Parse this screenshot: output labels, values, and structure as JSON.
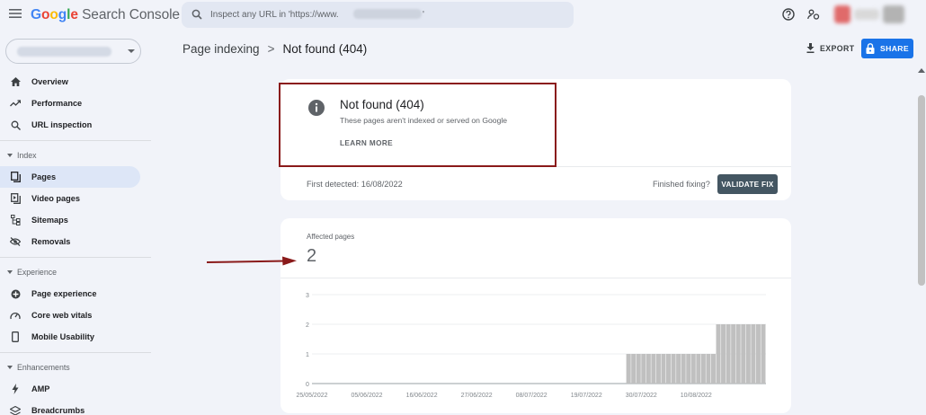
{
  "app": {
    "logo_google": "Google",
    "logo_product": "Search Console"
  },
  "search": {
    "placeholder": "Inspect any URL in 'https://www.",
    "placeholder_end": "'"
  },
  "header": {
    "breadcrumb_parent": "Page indexing",
    "breadcrumb_separator": ">",
    "breadcrumb_current": "Not found (404)",
    "export_label": "EXPORT",
    "share_label": "SHARE"
  },
  "sidebar": {
    "items": [
      {
        "label": "Overview",
        "icon": "home-icon"
      },
      {
        "label": "Performance",
        "icon": "trending-icon"
      },
      {
        "label": "URL inspection",
        "icon": "search-icon"
      }
    ],
    "sections": [
      {
        "title": "Index",
        "items": [
          {
            "label": "Pages",
            "icon": "pages-icon",
            "active": true
          },
          {
            "label": "Video pages",
            "icon": "video-pages-icon"
          },
          {
            "label": "Sitemaps",
            "icon": "sitemap-icon"
          },
          {
            "label": "Removals",
            "icon": "removals-icon"
          }
        ]
      },
      {
        "title": "Experience",
        "items": [
          {
            "label": "Page experience",
            "icon": "page-experience-icon"
          },
          {
            "label": "Core web vitals",
            "icon": "speed-icon"
          },
          {
            "label": "Mobile Usability",
            "icon": "mobile-icon"
          }
        ]
      },
      {
        "title": "Enhancements",
        "items": [
          {
            "label": "AMP",
            "icon": "amp-icon"
          },
          {
            "label": "Breadcrumbs",
            "icon": "breadcrumbs-icon"
          }
        ]
      }
    ]
  },
  "issue_card": {
    "title": "Not found (404)",
    "subtitle": "These pages aren't indexed or served on Google",
    "learn_more": "LEARN MORE",
    "first_detected": "First detected: 16/08/2022",
    "finished_fixing": "Finished fixing?",
    "validate_label": "VALIDATE FIX"
  },
  "affected_card": {
    "label": "Affected pages",
    "value": "2"
  },
  "colors": {
    "accent": "#1a73e8",
    "validate_bg": "#445662",
    "highlight": "#8a1a1a",
    "bars": "#c0c0c0",
    "active_nav": "#dde6f7"
  },
  "chart_data": {
    "type": "bar",
    "ylim": [
      0,
      3
    ],
    "y_ticks": [
      0,
      1,
      2,
      3
    ],
    "x_tick_labels": [
      "25/05/2022",
      "05/06/2022",
      "16/06/2022",
      "27/06/2022",
      "08/07/2022",
      "19/07/2022",
      "30/07/2022",
      "10/08/2022"
    ],
    "start_date": "2022-05-25",
    "daily_values": [
      0,
      0,
      0,
      0,
      0,
      0,
      0,
      0,
      0,
      0,
      0,
      0,
      0,
      0,
      0,
      0,
      0,
      0,
      0,
      0,
      0,
      0,
      0,
      0,
      0,
      0,
      0,
      0,
      0,
      0,
      0,
      0,
      0,
      0,
      0,
      0,
      0,
      0,
      0,
      0,
      0,
      0,
      0,
      0,
      0,
      0,
      0,
      0,
      0,
      0,
      0,
      0,
      0,
      0,
      0,
      0,
      0,
      0,
      0,
      0,
      0,
      0,
      0,
      1,
      1,
      1,
      1,
      1,
      1,
      1,
      1,
      1,
      1,
      1,
      1,
      1,
      1,
      1,
      1,
      1,
      1,
      2,
      2,
      2,
      2,
      2,
      2,
      2,
      2,
      2,
      2
    ]
  }
}
